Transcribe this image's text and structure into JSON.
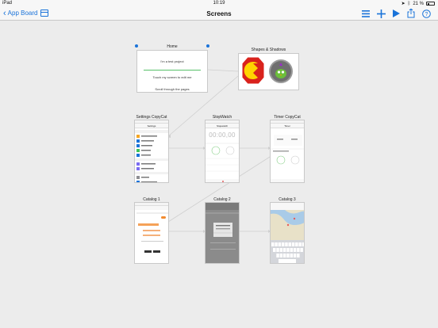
{
  "status": {
    "device": "iPad",
    "time": "10:19",
    "battery": "21 %"
  },
  "nav": {
    "back_label": "App Board",
    "title": "Screens"
  },
  "colors": {
    "accent": "#1a73d9",
    "connector": "#c8c8c8",
    "pacman_bg": "#d9221c",
    "pacman": "#ffd400"
  },
  "screens": {
    "home": {
      "label": "Home",
      "lines": [
        "I'm a test project",
        "Touch my screen to edit me",
        "Scroll through the pages"
      ]
    },
    "shapes": {
      "label": "Shapes & Shadows"
    },
    "settings": {
      "label": "Settings CopyCat",
      "title": "Settings"
    },
    "stopwatch": {
      "label": "StopWatch CopyCat",
      "title": "Stopwatch",
      "readout": "00:00,00"
    },
    "timer": {
      "label": "Timer CopyCat",
      "title": "Timer"
    },
    "catalog1": {
      "label": "Catalog 1"
    },
    "catalog2": {
      "label": "Catalog 2"
    },
    "catalog3": {
      "label": "Catalog 3"
    }
  }
}
